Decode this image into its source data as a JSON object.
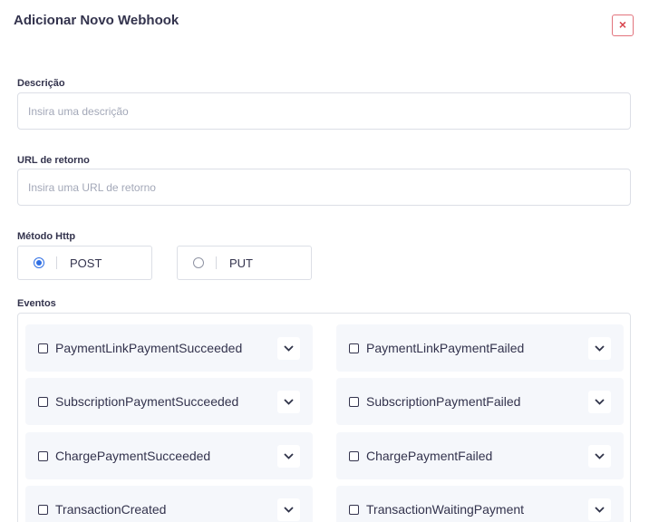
{
  "modal": {
    "title": "Adicionar Novo Webhook",
    "close_label": "×"
  },
  "description": {
    "label": "Descrição",
    "value": "",
    "placeholder": "Insira uma descrição"
  },
  "return_url": {
    "label": "URL de retorno",
    "value": "",
    "placeholder": "Insira uma URL de retorno"
  },
  "http_method": {
    "label": "Método Http",
    "options": [
      {
        "label": "POST",
        "checked": true
      },
      {
        "label": "PUT",
        "checked": false
      }
    ]
  },
  "events": {
    "label": "Eventos",
    "items": [
      {
        "name": "PaymentLinkPaymentSucceeded",
        "checked": false
      },
      {
        "name": "PaymentLinkPaymentFailed",
        "checked": false
      },
      {
        "name": "SubscriptionPaymentSucceeded",
        "checked": false
      },
      {
        "name": "SubscriptionPaymentFailed",
        "checked": false
      },
      {
        "name": "ChargePaymentSucceeded",
        "checked": false
      },
      {
        "name": "ChargePaymentFailed",
        "checked": false
      },
      {
        "name": "TransactionCreated",
        "checked": false
      },
      {
        "name": "TransactionWaitingPayment",
        "checked": false
      }
    ]
  },
  "icons": {
    "close": "close-icon",
    "expand": "chevron-down-icon",
    "radio": "radio-icon",
    "checkbox": "checkbox-icon"
  },
  "colors": {
    "accent": "#2f6fe4",
    "close_red": "#d9464f",
    "text": "#33334d",
    "placeholder": "#a3a8b8",
    "event_bg": "#f5f7fb"
  }
}
